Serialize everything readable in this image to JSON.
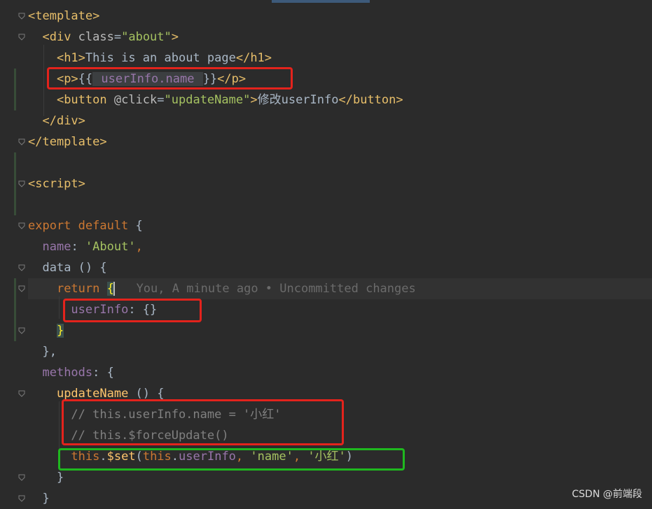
{
  "editor": {
    "lines": [
      {
        "tokens": [
          {
            "cls": "t",
            "text": "<template>"
          }
        ]
      },
      {
        "tokens": [
          {
            "cls": "x",
            "text": "  "
          },
          {
            "cls": "t",
            "text": "<div "
          },
          {
            "cls": "a",
            "text": "class"
          },
          {
            "cls": "x",
            "text": "="
          },
          {
            "cls": "s",
            "text": "\"about\""
          },
          {
            "cls": "t",
            "text": ">"
          }
        ]
      },
      {
        "tokens": [
          {
            "cls": "x",
            "text": "    "
          },
          {
            "cls": "t",
            "text": "<h1>"
          },
          {
            "cls": "x",
            "text": "This is an about page"
          },
          {
            "cls": "t",
            "text": "</h1>"
          }
        ]
      },
      {
        "tokens": [
          {
            "cls": "x",
            "text": "    "
          },
          {
            "cls": "t",
            "text": "<p>"
          },
          {
            "cls": "x",
            "text": "{{"
          },
          {
            "cls": "interp",
            "text": " userInfo.name "
          },
          {
            "cls": "x",
            "text": "}}"
          },
          {
            "cls": "t",
            "text": "</p>"
          }
        ]
      },
      {
        "tokens": [
          {
            "cls": "x",
            "text": "    "
          },
          {
            "cls": "t",
            "text": "<button "
          },
          {
            "cls": "a",
            "text": "@click"
          },
          {
            "cls": "x",
            "text": "="
          },
          {
            "cls": "s",
            "text": "\"updateName\""
          },
          {
            "cls": "t",
            "text": ">"
          },
          {
            "cls": "x",
            "text": "修改userInfo"
          },
          {
            "cls": "t",
            "text": "</button>"
          }
        ]
      },
      {
        "tokens": [
          {
            "cls": "x",
            "text": "  "
          },
          {
            "cls": "t",
            "text": "</div>"
          }
        ]
      },
      {
        "tokens": [
          {
            "cls": "t",
            "text": "</template>"
          }
        ]
      },
      {
        "tokens": []
      },
      {
        "tokens": [
          {
            "cls": "t",
            "text": "<script>"
          }
        ]
      },
      {
        "tokens": []
      },
      {
        "tokens": [
          {
            "cls": "k",
            "text": "export default "
          },
          {
            "cls": "x",
            "text": "{"
          }
        ]
      },
      {
        "tokens": [
          {
            "cls": "x",
            "text": "  "
          },
          {
            "cls": "p",
            "text": "name"
          },
          {
            "cls": "x",
            "text": ": "
          },
          {
            "cls": "s",
            "text": "'About'"
          },
          {
            "cls": "k",
            "text": ","
          }
        ]
      },
      {
        "tokens": [
          {
            "cls": "x",
            "text": "  "
          },
          {
            "cls": "f2",
            "text": "data"
          },
          {
            "cls": "x",
            "text": " () {"
          }
        ]
      },
      {
        "tokens": [
          {
            "cls": "x",
            "text": "    "
          },
          {
            "cls": "k",
            "text": "return "
          },
          {
            "cls": "brace",
            "text": "{"
          },
          {
            "cls": "caret",
            "text": ""
          },
          {
            "cls": "hint",
            "text": "   You, A minute ago • Uncommitted changes"
          }
        ]
      },
      {
        "tokens": [
          {
            "cls": "x",
            "text": "      "
          },
          {
            "cls": "p",
            "text": "userInfo"
          },
          {
            "cls": "x",
            "text": ": {}"
          }
        ]
      },
      {
        "tokens": [
          {
            "cls": "x",
            "text": "    "
          },
          {
            "cls": "brace",
            "text": "}"
          }
        ]
      },
      {
        "tokens": [
          {
            "cls": "x",
            "text": "  },"
          }
        ]
      },
      {
        "tokens": [
          {
            "cls": "x",
            "text": "  "
          },
          {
            "cls": "p",
            "text": "methods"
          },
          {
            "cls": "x",
            "text": ": {"
          }
        ]
      },
      {
        "tokens": [
          {
            "cls": "x",
            "text": "    "
          },
          {
            "cls": "f",
            "text": "updateName"
          },
          {
            "cls": "x",
            "text": " () {"
          }
        ]
      },
      {
        "tokens": [
          {
            "cls": "x",
            "text": "      "
          },
          {
            "cls": "c",
            "text": "// this.userInfo.name = '小红'"
          }
        ]
      },
      {
        "tokens": [
          {
            "cls": "x",
            "text": "      "
          },
          {
            "cls": "c",
            "text": "// this.$forceUpdate()"
          }
        ]
      },
      {
        "tokens": [
          {
            "cls": "x",
            "text": "      "
          },
          {
            "cls": "k",
            "text": "this"
          },
          {
            "cls": "x",
            "text": "."
          },
          {
            "cls": "f",
            "text": "$set"
          },
          {
            "cls": "x",
            "text": "("
          },
          {
            "cls": "k",
            "text": "this"
          },
          {
            "cls": "x",
            "text": "."
          },
          {
            "cls": "p",
            "text": "userInfo"
          },
          {
            "cls": "k",
            "text": ", "
          },
          {
            "cls": "s",
            "text": "'name'"
          },
          {
            "cls": "k",
            "text": ", "
          },
          {
            "cls": "s",
            "text": "'小红'"
          },
          {
            "cls": "x",
            "text": ")"
          }
        ]
      },
      {
        "tokens": [
          {
            "cls": "x",
            "text": "    }"
          }
        ]
      },
      {
        "tokens": [
          {
            "cls": "x",
            "text": "  }"
          }
        ]
      }
    ]
  },
  "watermark": "CSDN @前端段",
  "colors": {
    "background": "#2b2b2b",
    "red_highlight": "#e3231c",
    "green_highlight": "#1fb81f"
  }
}
